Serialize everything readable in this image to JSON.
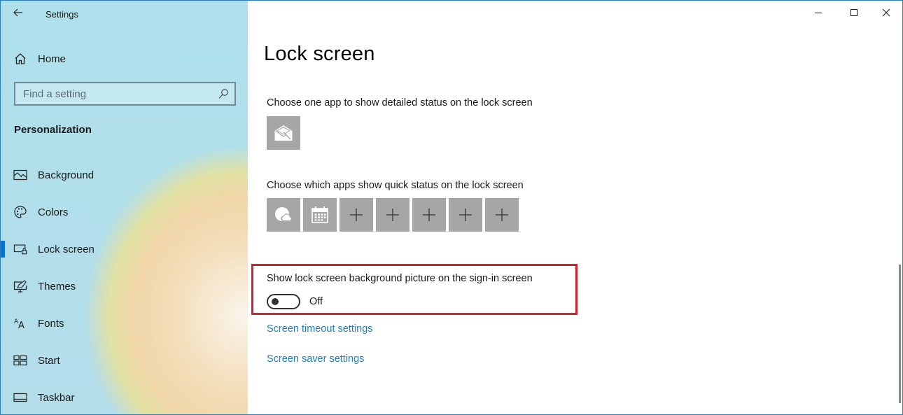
{
  "window": {
    "title": "Settings",
    "controls": {
      "minimize": "minimize",
      "maximize": "maximize",
      "close": "close"
    }
  },
  "sidebar": {
    "home_label": "Home",
    "search": {
      "placeholder": "Find a setting",
      "value": ""
    },
    "section_title": "Personalization",
    "items": [
      {
        "label": "Background",
        "icon": "picture-icon",
        "active": false
      },
      {
        "label": "Colors",
        "icon": "palette-icon",
        "active": false
      },
      {
        "label": "Lock screen",
        "icon": "lock-screen-icon",
        "active": true
      },
      {
        "label": "Themes",
        "icon": "themes-icon",
        "active": false
      },
      {
        "label": "Fonts",
        "icon": "fonts-icon",
        "active": false
      },
      {
        "label": "Start",
        "icon": "start-icon",
        "active": false
      },
      {
        "label": "Taskbar",
        "icon": "taskbar-icon",
        "active": false
      }
    ],
    "accent_color": "#0a6fd6"
  },
  "main": {
    "page_title": "Lock screen",
    "detailed_status": {
      "label": "Choose one app to show detailed status on the lock screen",
      "app": "mail-icon"
    },
    "quick_status": {
      "label": "Choose which apps show quick status on the lock screen",
      "apps": [
        "weather-icon",
        "calendar-icon",
        "add-icon",
        "add-icon",
        "add-icon",
        "add-icon",
        "add-icon"
      ]
    },
    "signin_background": {
      "label": "Show lock screen background picture on the sign-in screen",
      "toggle_on": false,
      "toggle_state_text": "Off",
      "highlight_color": "#d1222c"
    },
    "links": {
      "screen_timeout": "Screen timeout settings",
      "screen_saver": "Screen saver settings"
    },
    "link_color": "#1f7fb6"
  }
}
